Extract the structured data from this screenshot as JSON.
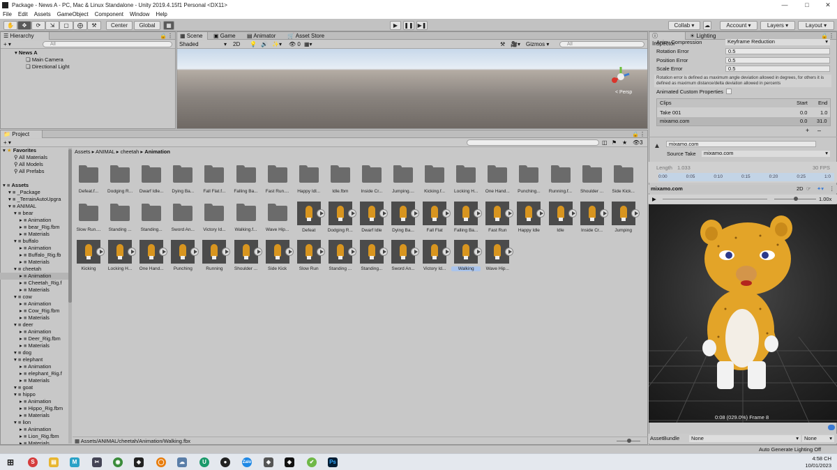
{
  "window": {
    "title": "Package - News A - PC, Mac & Linux Standalone - Unity 2019.4.15f1 Personal <DX11>"
  },
  "menu": [
    "File",
    "Edit",
    "Assets",
    "GameObject",
    "Component",
    "Window",
    "Help"
  ],
  "toolbar": {
    "center_label": "Center",
    "global_label": "Global",
    "collab_label": "Collab ▾",
    "account_label": "Account",
    "layers_label": "Layers",
    "layout_label": "Layout"
  },
  "hierarchy": {
    "tab": "Hierarchy",
    "search_placeholder": "All",
    "scene": "News A",
    "items": [
      "Main Camera",
      "Directional Light"
    ]
  },
  "scene_tabs": [
    "Scene",
    "Game",
    "Animator",
    "Asset Store"
  ],
  "scene_ctl": {
    "shaded": "Shaded",
    "mode2d": "2D",
    "gizmos": "Gizmos",
    "search_placeholder": "All",
    "persp": "< Persp",
    "fx_count": "0"
  },
  "project": {
    "tab": "Project",
    "favorites": {
      "label": "Favorites",
      "items": [
        "All Materials",
        "All Models",
        "All Prefabs"
      ]
    },
    "tree_rows": [
      {
        "label": "Assets",
        "indent": 0,
        "bold": true
      },
      {
        "label": "_Package",
        "indent": 1
      },
      {
        "label": "_TerrainAutoUpgra",
        "indent": 1
      },
      {
        "label": "ANIMAL",
        "indent": 1
      },
      {
        "label": "bear",
        "indent": 2
      },
      {
        "label": "Animation",
        "indent": 3
      },
      {
        "label": "bear_Rig.fbm",
        "indent": 3
      },
      {
        "label": "Materials",
        "indent": 3
      },
      {
        "label": "buffalo",
        "indent": 2
      },
      {
        "label": "Animation",
        "indent": 3
      },
      {
        "label": "Buffalo_Rig.fb",
        "indent": 3
      },
      {
        "label": "Materials",
        "indent": 3
      },
      {
        "label": "cheetah",
        "indent": 2
      },
      {
        "label": "Animation",
        "indent": 3,
        "selected": true
      },
      {
        "label": "Cheetah_Rig.f",
        "indent": 3
      },
      {
        "label": "Materials",
        "indent": 3
      },
      {
        "label": "cow",
        "indent": 2
      },
      {
        "label": "Animation",
        "indent": 3
      },
      {
        "label": "Cow_Rig.fbm",
        "indent": 3
      },
      {
        "label": "Materials",
        "indent": 3
      },
      {
        "label": "deer",
        "indent": 2
      },
      {
        "label": "Animation",
        "indent": 3
      },
      {
        "label": "Deer_Rig.fbm",
        "indent": 3
      },
      {
        "label": "Materials",
        "indent": 3
      },
      {
        "label": "dog",
        "indent": 2
      },
      {
        "label": "elephant",
        "indent": 2
      },
      {
        "label": "Animation",
        "indent": 3
      },
      {
        "label": "elephant_Rig.f",
        "indent": 3
      },
      {
        "label": "Materials",
        "indent": 3
      },
      {
        "label": "goat",
        "indent": 2
      },
      {
        "label": "hippo",
        "indent": 2
      },
      {
        "label": "Animation",
        "indent": 3
      },
      {
        "label": "Hippo_Rig.fbm",
        "indent": 3
      },
      {
        "label": "Materials",
        "indent": 3
      },
      {
        "label": "lion",
        "indent": 2
      },
      {
        "label": "Animation",
        "indent": 3
      },
      {
        "label": "Lion_Rig.fbm",
        "indent": 3
      },
      {
        "label": "Materials",
        "indent": 3
      }
    ],
    "breadcrumb": [
      "Assets",
      "ANIMAL",
      "cheetah",
      "Animation"
    ],
    "item_count": "3",
    "folders": [
      "Defeat.f...",
      "Dodging R...",
      "Dwarf Idle...",
      "Dying Ba...",
      "Fall Flat.f...",
      "Falling Ba...",
      "Fast Run....",
      "Happy Idl...",
      "Idle.fbm",
      "Inside Cr...",
      "Jumping....",
      "Kicking.f...",
      "Locking H...",
      "One Hand...",
      "Punching...",
      "Running.f...",
      "Shoulder ...",
      "Side Kick...",
      "Slow Run....",
      "Standing ...",
      "Standing...",
      "Sword An...",
      "Victory Id...",
      "Walking.f...",
      "Wave Hip..."
    ],
    "anims": [
      "Defeat",
      "Dodging R...",
      "Dwarf Idle",
      "Dying Ba...",
      "Fall Flat",
      "Falling Ba...",
      "Fast Run",
      "Happy Idle",
      "Idle",
      "Inside Cr...",
      "Jumping",
      "Kicking",
      "Locking H...",
      "One Hand...",
      "Punching",
      "Running",
      "Shoulder ...",
      "Side Kick",
      "Slow Run",
      "Standing ...",
      "Standing...",
      "Sword An...",
      "Victory Id...",
      "Walking",
      "Wave Hip..."
    ],
    "selected_anim": "Walking",
    "path": "Assets/ANIMAL/cheetah/Animation/Walking.fbx"
  },
  "inspector": {
    "tabs": [
      "Inspector",
      "Lighting"
    ],
    "fields": [
      {
        "label": "Anim. Compression",
        "value": "Keyframe Reduction"
      },
      {
        "label": "Rotation Error",
        "value": "0.5"
      },
      {
        "label": "Position Error",
        "value": "0.5"
      },
      {
        "label": "Scale Error",
        "value": "0.5"
      }
    ],
    "help": "Rotation error is defined as maximum angle deviation allowed in degrees, for others it is defined as maximum distance/delta deviation allowed in percents",
    "custom_props": "Animated Custom Properties",
    "clips": {
      "header": [
        "Clips",
        "Start",
        "End"
      ],
      "rows": [
        [
          "Take 001",
          "0.0",
          "1.0"
        ],
        [
          "mixamo.com",
          "0.0",
          "31.0"
        ]
      ]
    },
    "clip_name": "mixamo.com",
    "source_take_label": "Source Take",
    "source_take_value": "mixamo.com",
    "length_label": "Length",
    "length_value": "1.033",
    "fps": "30 FPS",
    "timeline": [
      "0:00",
      "0:05",
      "0:10",
      "0:15",
      "0:20",
      "0:25",
      "1:0"
    ],
    "preview_name": "mixamo.com",
    "preview_2d": "2D",
    "speed": "1.00x",
    "preview_time": "0:08 (029.0%) Frame 8",
    "assetbundle_label": "AssetBundle",
    "assetbundle_value": "None",
    "assetbundle_variant": "None"
  },
  "status": {
    "text": "Auto Generate Lighting Off"
  },
  "taskbar": {
    "time": "4:58 CH",
    "date": "10/01/2023"
  },
  "colors": {
    "accent": "#3a7bd5",
    "preview_bg": "#262626",
    "cheetah": "#e3a428"
  }
}
